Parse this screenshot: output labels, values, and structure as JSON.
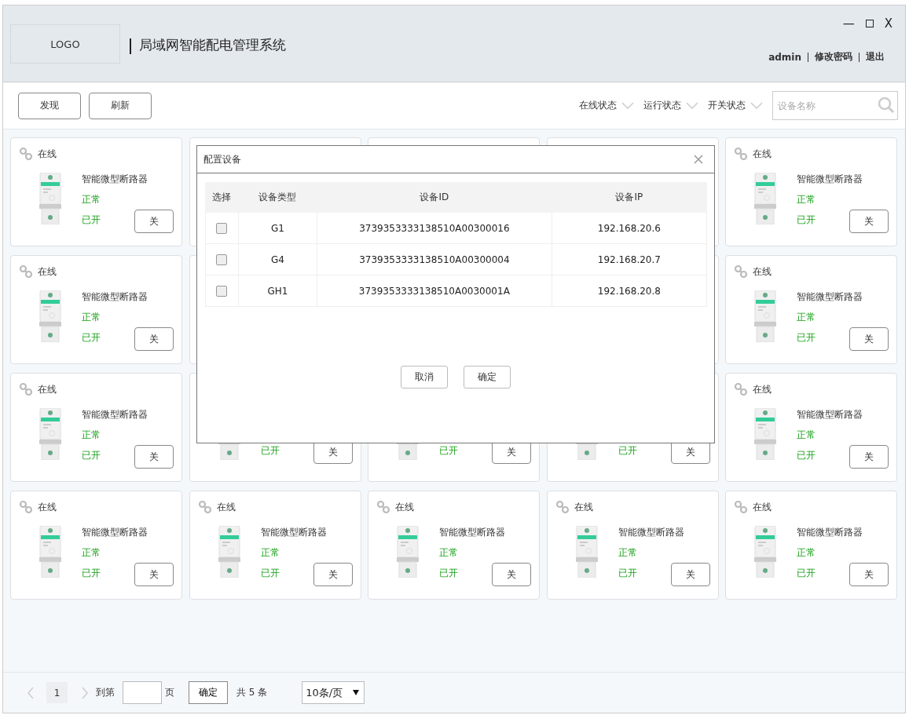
{
  "header": {
    "logo": "LOGO",
    "title": "局域网智能配电管理系统",
    "window_controls": {
      "minimize": "—",
      "close": "X"
    },
    "user": "admin",
    "links": [
      "修改密码",
      "退出"
    ]
  },
  "toolbar": {
    "buttons": [
      "发现",
      "刷新"
    ],
    "filters": [
      "在线状态",
      "运行状态",
      "开关状态"
    ],
    "search": {
      "placeholder": "设备名称"
    }
  },
  "cards": [
    {
      "status": "在线",
      "name": "智能微型断路器",
      "run_state": "正常",
      "switch_state": "已开",
      "button": "关"
    },
    {
      "status": "在线",
      "name": "智能微型断路器",
      "run_state": "正常",
      "switch_state": "已开",
      "button": "关"
    },
    {
      "status": "在线",
      "name": "智能微型断路器",
      "run_state": "正常",
      "switch_state": "已开",
      "button": "关"
    },
    {
      "status": "在线",
      "name": "智能微型断路器",
      "run_state": "正常",
      "switch_state": "已开",
      "button": "关"
    },
    {
      "status": "在线",
      "name": "智能微型断路器",
      "run_state": "正常",
      "switch_state": "已开",
      "button": "关"
    },
    {
      "switch_state": "已开",
      "button": "关"
    },
    {
      "switch_state": "已开",
      "button": "关"
    },
    {
      "switch_state": "已开",
      "button": "关"
    },
    {
      "status": "在线",
      "name": "智能微型断路器",
      "run_state": "正常",
      "switch_state": "已开",
      "button": "关"
    },
    {
      "status": "在线",
      "name": "智能微型断路器",
      "run_state": "正常",
      "switch_state": "已开",
      "button": "关"
    },
    {
      "status": "在线",
      "name": "智能微型断路器",
      "run_state": "正常",
      "switch_state": "已开",
      "button": "关"
    },
    {
      "status": "在线",
      "name": "智能微型断路器",
      "run_state": "正常",
      "switch_state": "已开",
      "button": "关"
    },
    {
      "status": "在线",
      "name": "智能微型断路器",
      "run_state": "正常",
      "switch_state": "已开",
      "button": "关"
    },
    {
      "status": "在线",
      "name": "智能微型断路器",
      "run_state": "正常",
      "switch_state": "已开",
      "button": "关"
    }
  ],
  "dialog": {
    "title": "配置设备",
    "columns": [
      "选择",
      "设备类型",
      "设备ID",
      "设备IP"
    ],
    "rows": [
      {
        "checked": false,
        "type": "G1",
        "id": "3739353333138510A00300016",
        "ip": "192.168.20.6"
      },
      {
        "checked": false,
        "type": "G4",
        "id": "3739353333138510A00300004",
        "ip": "192.168.20.7"
      },
      {
        "checked": false,
        "type": "GH1",
        "id": "3739353333138510A0030001A",
        "ip": "192.168.20.8"
      }
    ],
    "buttons": [
      "取消",
      "确定"
    ]
  },
  "pagination": {
    "pages": [
      {
        "label": "1",
        "selected": true
      }
    ],
    "goto_label": "到第",
    "page_unit": "页",
    "confirm": "确定",
    "total": "共 5 条",
    "page_size": "10条/页"
  }
}
